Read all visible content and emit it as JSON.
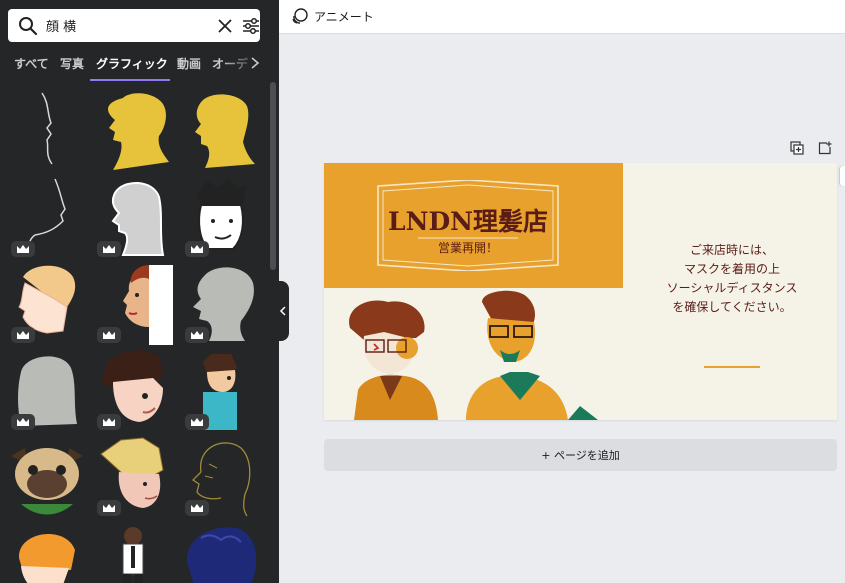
{
  "search": {
    "value": "顔 横",
    "placeholder": ""
  },
  "tabs": [
    {
      "label": "すべて",
      "active": false
    },
    {
      "label": "写真",
      "active": false
    },
    {
      "label": "グラフィック",
      "active": true
    },
    {
      "label": "動画",
      "active": false
    },
    {
      "label": "オーデ",
      "active": false
    }
  ],
  "colors": {
    "accent": "#8b7cf6",
    "panel": "#252627",
    "canvas_bg": "#ebecf0",
    "slide_orange": "#e8a12c",
    "slide_cream": "#f5f3e8",
    "slide_text": "#5a1c16"
  },
  "topbar": {
    "animate_label": "アニメート"
  },
  "slide": {
    "title": "LNDN理髪店",
    "subtitle": "営業再開！",
    "message_lines": [
      "ご来店時には、",
      "マスクを着用の上",
      "ソーシャルディスタンス",
      "を確保してください。"
    ]
  },
  "canvas": {
    "add_page_label": "+ ページを追加"
  },
  "graphics": [
    {
      "name": "line-profile-face",
      "premium": false
    },
    {
      "name": "yellow-woman-silhouette",
      "premium": false
    },
    {
      "name": "yellow-man-silhouette",
      "premium": false
    },
    {
      "name": "line-profile-chin",
      "premium": true
    },
    {
      "name": "grey-woman-profile",
      "premium": true
    },
    {
      "name": "cartoon-man-black-hair",
      "premium": true
    },
    {
      "name": "blond-man-profile",
      "premium": true
    },
    {
      "name": "redhead-woman-half",
      "premium": true
    },
    {
      "name": "grey-head-silhouette",
      "premium": true
    },
    {
      "name": "grey-woman-silhouette",
      "premium": true
    },
    {
      "name": "cartoon-boy-brown-hair",
      "premium": true
    },
    {
      "name": "cartoon-boy-side",
      "premium": true
    },
    {
      "name": "pug-face",
      "premium": false
    },
    {
      "name": "blond-man-sketch",
      "premium": true
    },
    {
      "name": "line-head-gold",
      "premium": true
    },
    {
      "name": "orange-hair-head",
      "premium": false
    },
    {
      "name": "businessman-thinking",
      "premium": false
    },
    {
      "name": "blue-curly-hair",
      "premium": false
    }
  ]
}
